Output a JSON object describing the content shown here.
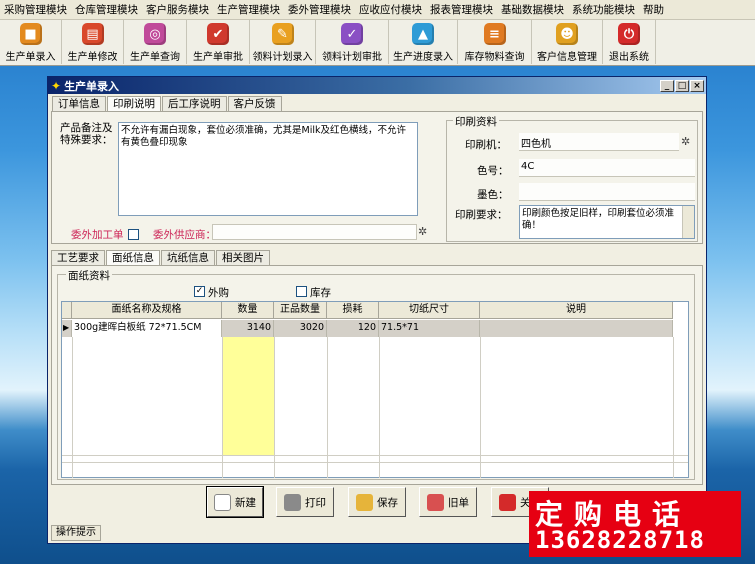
{
  "menu": [
    "采购管理模块",
    "仓库管理模块",
    "客户服务模块",
    "生产管理模块",
    "委外管理模块",
    "应收应付模块",
    "报表管理模块",
    "基础数据模块",
    "系统功能模块",
    "帮助"
  ],
  "toolbar": [
    {
      "label": "生产单录入",
      "icon": "box-icon",
      "color": "#e38a1f"
    },
    {
      "label": "生产单修改",
      "icon": "folder-icon",
      "color": "#d9482b"
    },
    {
      "label": "生产单查询",
      "icon": "search-icon",
      "color": "#c04a9a"
    },
    {
      "label": "生产单审批",
      "icon": "approve-icon",
      "color": "#d0392e"
    },
    {
      "label": "领料计划录入",
      "icon": "pencil-icon",
      "color": "#e9a020"
    },
    {
      "label": "领料计划审批",
      "icon": "check-icon",
      "color": "#8a4fc4"
    },
    {
      "label": "生产进度录入",
      "icon": "chart-icon",
      "color": "#2e9bd6"
    },
    {
      "label": "库存物料查询",
      "icon": "stack-icon",
      "color": "#e07a22"
    },
    {
      "label": "客户信息管理",
      "icon": "people-icon",
      "color": "#e0a020"
    },
    {
      "label": "退出系统",
      "icon": "power-icon",
      "color": "#d42a2a"
    }
  ],
  "window": {
    "title": "生产单录入",
    "buttons": [
      "_",
      "□",
      "×"
    ]
  },
  "tabs_top": [
    "订单信息",
    "印刷说明",
    "后工序说明",
    "客户反馈"
  ],
  "print_desc": {
    "remark_label": "产品备注及\n特殊要求：",
    "remark_value": "不允许有漏白现象，套位必须准确，尤其是Milk及红色横线，不允许有黄色叠印现象",
    "outsource_label": "委外加工单",
    "supplier_label": "委外供应商："
  },
  "print_info": {
    "group_title": "印刷资料",
    "press_label": "印刷机：",
    "press_value": "四色机",
    "color_label": "色号：",
    "color_value": "4C",
    "ink_label": "墨色：",
    "ink_value": "",
    "req_label": "印刷要求：",
    "req_value": "印刷颜色按足旧样，印刷套位必须准确！"
  },
  "tabs_bottom": [
    "工艺要求",
    "面纸信息",
    "坑纸信息",
    "相关图片"
  ],
  "paper": {
    "group_title": "面纸资料",
    "opt_outsource": "外购",
    "opt_outsource_checked": true,
    "opt_stock": "库存",
    "opt_stock_checked": false,
    "columns": [
      "面纸名称及规格",
      "数量",
      "正品数量",
      "损耗",
      "切纸尺寸",
      "说明"
    ],
    "rows": [
      {
        "name": "300g建晖白板纸  72*71.5CM",
        "qty": "3140",
        "good": "3020",
        "loss": "120",
        "cut": "71.5*71",
        "note": ""
      }
    ]
  },
  "actions": [
    "新建",
    "打印",
    "保存",
    "旧单",
    "关闭"
  ],
  "status": "操作提示",
  "promo": {
    "line1": "定购电话",
    "line2": "13628228718"
  }
}
